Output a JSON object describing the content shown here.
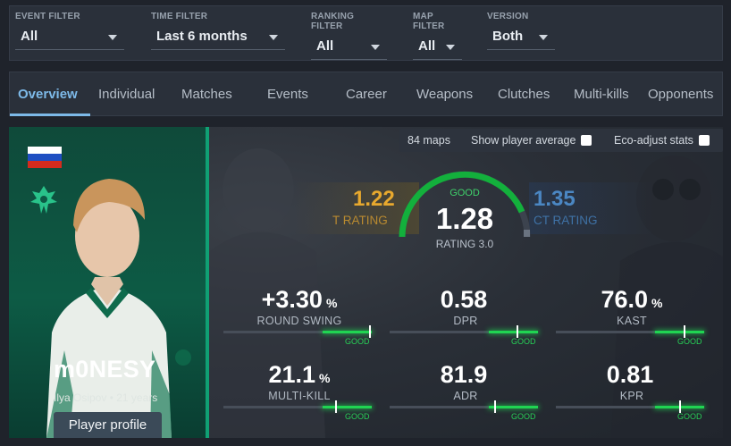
{
  "filters": [
    {
      "label": "EVENT FILTER",
      "value": "All"
    },
    {
      "label": "TIME FILTER",
      "value": "Last 6 months"
    },
    {
      "label": "RANKING FILTER",
      "value": "All"
    },
    {
      "label": "MAP FILTER",
      "value": "All"
    },
    {
      "label": "VERSION",
      "value": "Both"
    }
  ],
  "tabs": [
    "Overview",
    "Individual",
    "Matches",
    "Events",
    "Career",
    "Weapons",
    "Clutches",
    "Multi-kills",
    "Opponents"
  ],
  "active_tab": "Overview",
  "options": {
    "maps": "84 maps",
    "show_average": "Show player average",
    "eco_adjust": "Eco-adjust stats"
  },
  "player": {
    "name": "m0NESY",
    "info": "Ilya Osipov • 21 years",
    "profile_button": "Player profile",
    "flag_colors": [
      "#ffffff",
      "#1f4fc2",
      "#d52b1e"
    ]
  },
  "ratings": {
    "t_value": "1.22",
    "t_label": "T RATING",
    "ct_value": "1.35",
    "ct_label": "CT RATING",
    "grade": "GOOD",
    "main_value": "1.28",
    "main_label": "RATING 3.0"
  },
  "metrics": [
    {
      "value": "+3.30",
      "unit": "%",
      "label": "ROUND SWING",
      "grade": "GOOD",
      "fill_start": 0.67,
      "fill_end": 1.0,
      "tick": 0.99
    },
    {
      "value": "0.58",
      "unit": "",
      "label": "DPR",
      "grade": "GOOD",
      "fill_start": 0.67,
      "fill_end": 1.0,
      "tick": 0.86
    },
    {
      "value": "76.0",
      "unit": "%",
      "label": "KAST",
      "grade": "GOOD",
      "fill_start": 0.67,
      "fill_end": 1.0,
      "tick": 0.87
    },
    {
      "value": "21.1",
      "unit": "%",
      "label": "MULTI-KILL",
      "grade": "GOOD",
      "fill_start": 0.67,
      "fill_end": 1.0,
      "tick": 0.76
    },
    {
      "value": "81.9",
      "unit": "",
      "label": "ADR",
      "grade": "GOOD",
      "fill_start": 0.67,
      "fill_end": 1.0,
      "tick": 0.71
    },
    {
      "value": "0.81",
      "unit": "",
      "label": "KPR",
      "grade": "GOOD",
      "fill_start": 0.67,
      "fill_end": 1.0,
      "tick": 0.84
    }
  ],
  "colors": {
    "accent": "#7db9e8",
    "good": "#20d452",
    "t_side": "#e8a92e",
    "ct_side": "#4b87c3",
    "team": "#0d5b45"
  },
  "icons": {
    "caret": "chevron-down-icon",
    "team": "falcon-logo-icon",
    "flag": "russia-flag-icon"
  }
}
